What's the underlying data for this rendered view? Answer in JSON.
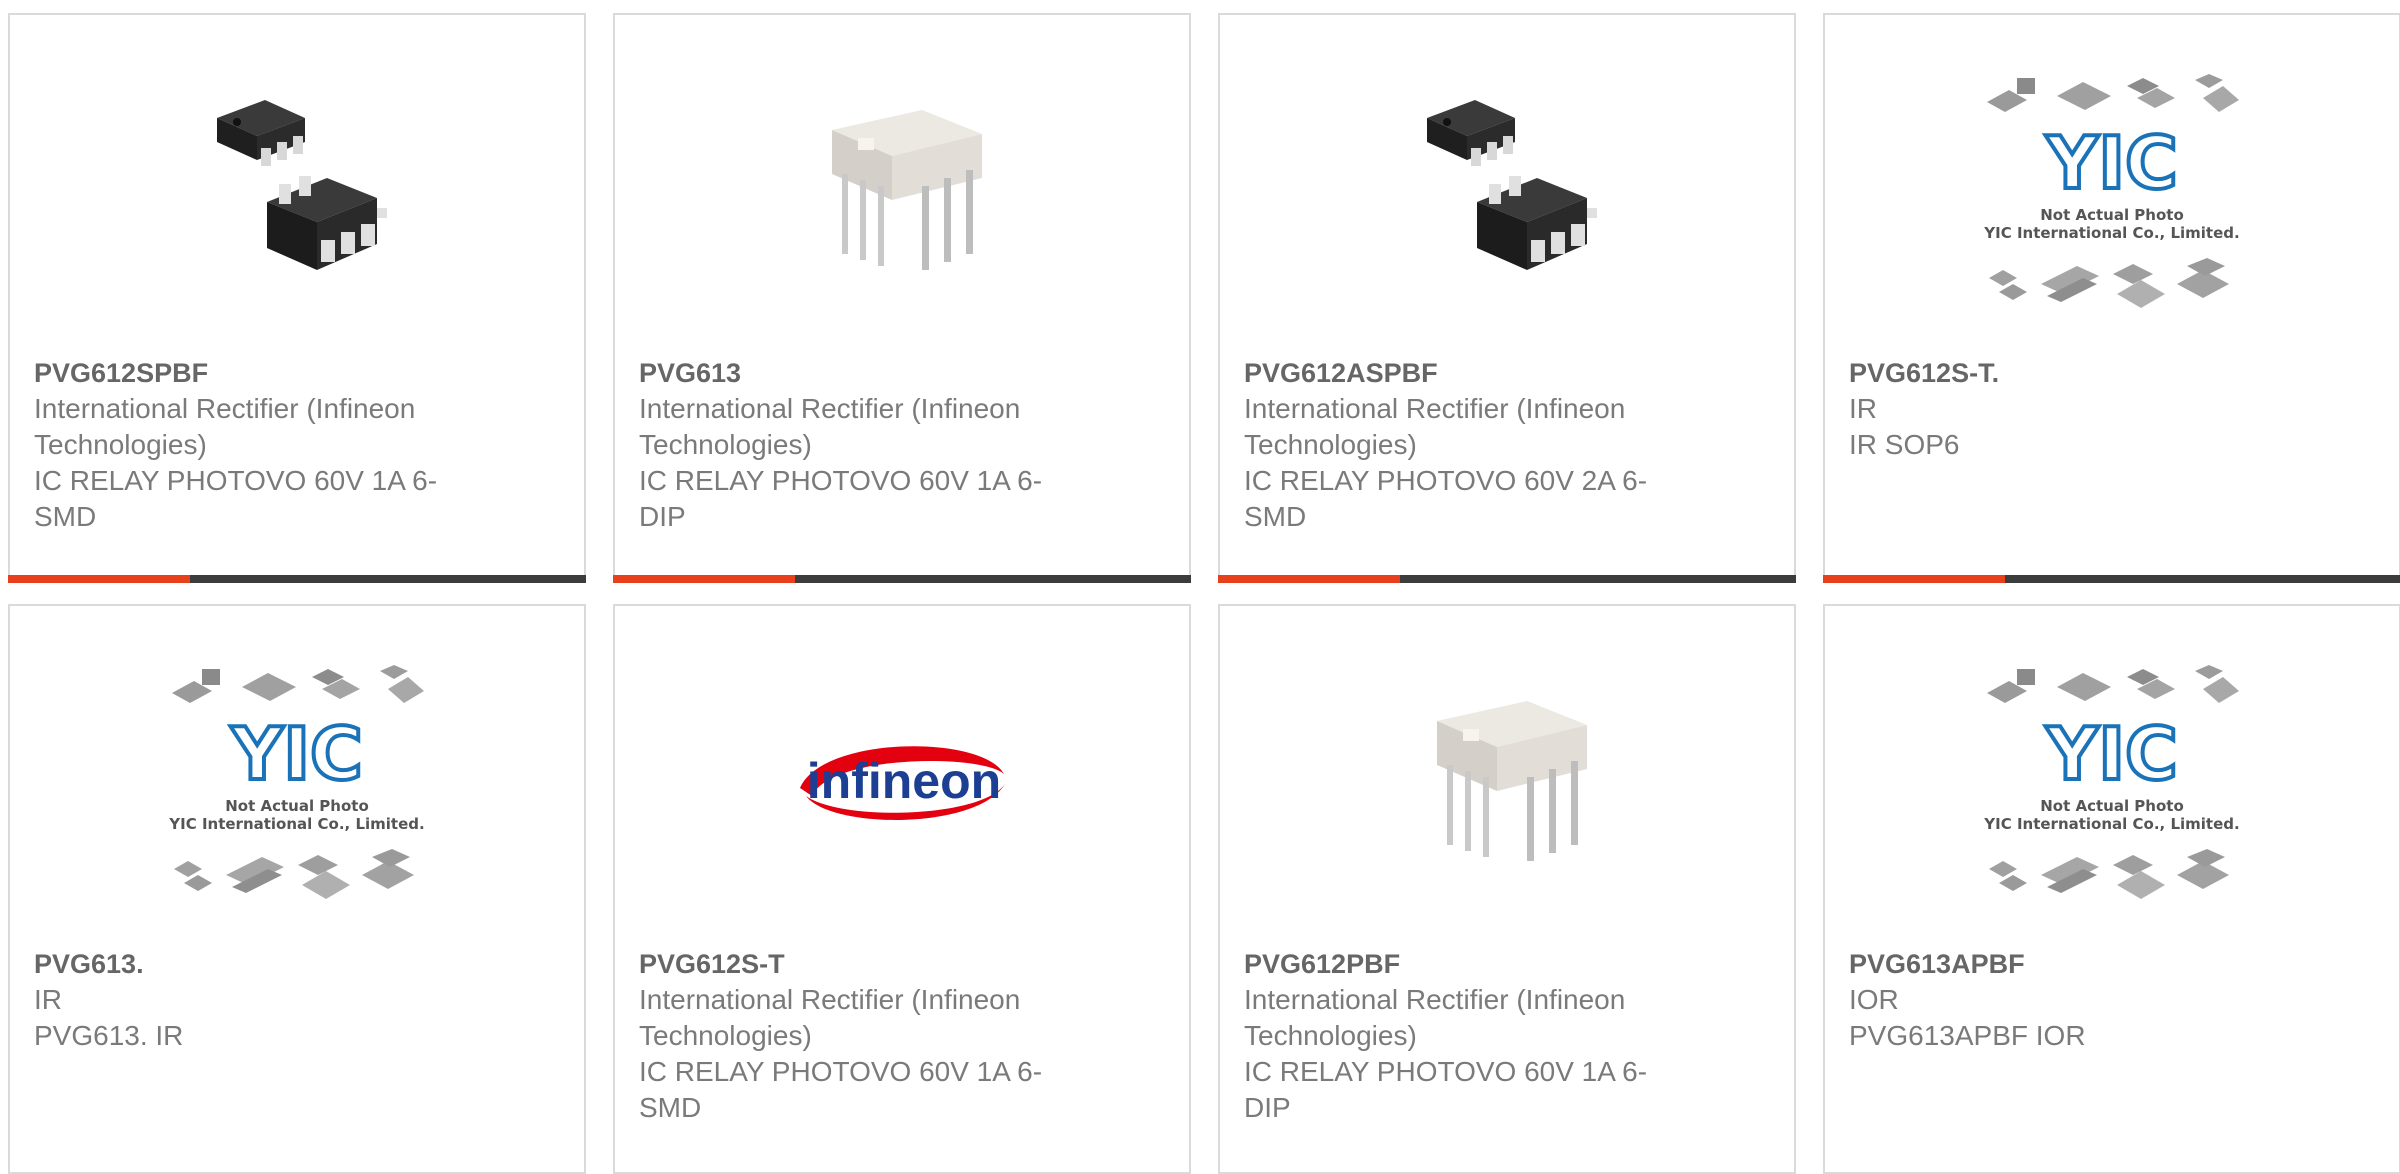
{
  "products": [
    {
      "part": "PVG612SPBF",
      "manufacturer_lines": [
        "International Rectifier (Infineon",
        "Technologies)"
      ],
      "description_lines": [
        "IC RELAY PHOTOVO 60V 1A 6-",
        "SMD"
      ],
      "image": "smd-package",
      "has_bar": true
    },
    {
      "part": "PVG613",
      "manufacturer_lines": [
        "International Rectifier (Infineon",
        "Technologies)"
      ],
      "description_lines": [
        "IC RELAY PHOTOVO 60V 1A 6-",
        "DIP"
      ],
      "image": "dip-package",
      "has_bar": true
    },
    {
      "part": "PVG612ASPBF",
      "manufacturer_lines": [
        "International Rectifier (Infineon",
        "Technologies)"
      ],
      "description_lines": [
        "IC RELAY PHOTOVO 60V 2A 6-",
        "SMD"
      ],
      "image": "smd-package",
      "has_bar": true
    },
    {
      "part": "PVG612S-T.",
      "manufacturer_lines": [
        "IR"
      ],
      "description_lines": [
        "IR SOP6"
      ],
      "image": "yic-placeholder",
      "has_bar": true
    },
    {
      "part": "PVG613.",
      "manufacturer_lines": [
        "IR"
      ],
      "description_lines": [
        "PVG613. IR"
      ],
      "image": "yic-placeholder",
      "has_bar": false
    },
    {
      "part": "PVG612S-T",
      "manufacturer_lines": [
        "International Rectifier (Infineon",
        "Technologies)"
      ],
      "description_lines": [
        "IC RELAY PHOTOVO 60V 1A 6-",
        "SMD"
      ],
      "image": "infineon-logo",
      "has_bar": false
    },
    {
      "part": "PVG612PBF",
      "manufacturer_lines": [
        "International Rectifier (Infineon",
        "Technologies)"
      ],
      "description_lines": [
        "IC RELAY PHOTOVO 60V 1A 6-",
        "DIP"
      ],
      "image": "dip-package",
      "has_bar": false
    },
    {
      "part": "PVG613APBF",
      "manufacturer_lines": [
        "IOR"
      ],
      "description_lines": [
        "PVG613APBF IOR"
      ],
      "image": "yic-placeholder",
      "has_bar": false
    }
  ],
  "placeholder": {
    "line1": "Not Actual Photo",
    "line2": "YIC International Co., Limited.",
    "logo_text": "YIC"
  },
  "infineon_logo_text": "infineon",
  "colors": {
    "accent": "#e8401c",
    "bar": "#3c3c3c",
    "border": "#dadada",
    "text": "#7a7a7a",
    "yic_blue": "#1a73b8",
    "infineon_blue": "#1c3f94",
    "infineon_red": "#e3000f"
  }
}
